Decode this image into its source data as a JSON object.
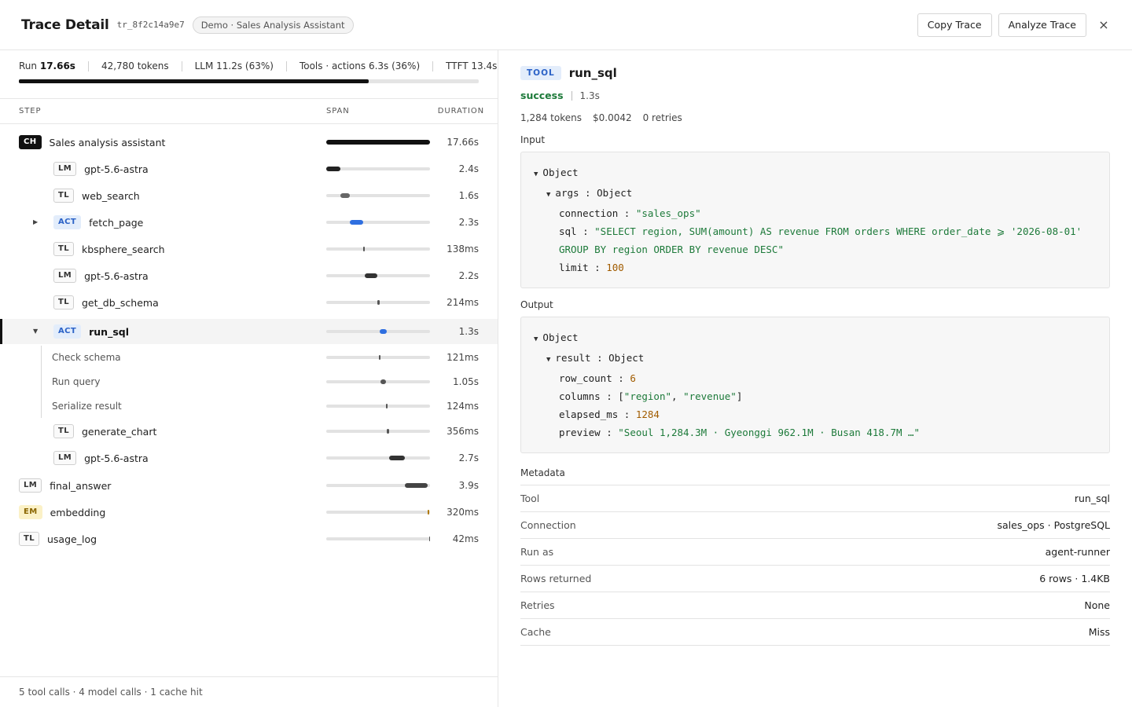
{
  "header": {
    "title": "Trace Detail",
    "trace_id": "tr_8f2c14a9e7",
    "demo_badge": "Demo · Sales Analysis Assistant",
    "copy_label": "Copy Trace",
    "analyze_label": "Analyze Trace",
    "close_icon": "×"
  },
  "summary": {
    "run_prefix": "Run",
    "run_value": "17.66s",
    "tokens": "42,780 tokens",
    "llm": "LLM 11.2s (63%)",
    "tools": "Tools · actions 6.3s (36%)",
    "ttft": "TTFT 13.4s",
    "progress_fraction": 0.76
  },
  "columns": {
    "step": "STEP",
    "span": "SPAN",
    "duration": "DURATION"
  },
  "rows": [
    {
      "tag": "CH",
      "name": "Sales analysis assistant",
      "duration": "17.66s"
    },
    {
      "tag": "LM",
      "name": "gpt-5.6-astra",
      "duration": "2.4s"
    },
    {
      "tag": "TL",
      "name": "web_search",
      "duration": "1.6s"
    },
    {
      "tag": "ACT",
      "name": "fetch_page",
      "duration": "2.3s"
    },
    {
      "tag": "TL",
      "name": "kbsphere_search",
      "duration": "138ms"
    },
    {
      "tag": "LM",
      "name": "gpt-5.6-astra",
      "duration": "2.2s"
    },
    {
      "tag": "TL",
      "name": "get_db_schema",
      "duration": "214ms"
    },
    {
      "tag": "ACT",
      "name": "run_sql",
      "duration": "1.3s"
    },
    {
      "name": "Check schema",
      "duration": "121ms"
    },
    {
      "name": "Run query",
      "duration": "1.05s"
    },
    {
      "name": "Serialize result",
      "duration": "124ms"
    },
    {
      "tag": "TL",
      "name": "generate_chart",
      "duration": "356ms"
    },
    {
      "tag": "LM",
      "name": "gpt-5.6-astra",
      "duration": "2.7s"
    },
    {
      "tag": "LM",
      "name": "final_answer",
      "duration": "3.9s"
    },
    {
      "tag": "EM",
      "name": "embedding",
      "duration": "320ms"
    },
    {
      "tag": "TL",
      "name": "usage_log",
      "duration": "42ms"
    }
  ],
  "footer": "5 tool calls · 4 model calls · 1 cache hit",
  "detail": {
    "badge": "TOOL",
    "title": "run_sql",
    "status": "success",
    "duration": "1.3s",
    "tokens": "1,284 tokens",
    "cost": "$0.0042",
    "retries": "0 retries",
    "input_label": "Input",
    "output_label": "Output",
    "obj": "Object",
    "args_key": "args",
    "connection_key": "connection",
    "connection_val": "\"sales_ops\"",
    "sql_key": "sql",
    "sql_val": "\"SELECT region, SUM(amount) AS revenue FROM orders WHERE order_date ⩾ '2026-08-01' GROUP BY region ORDER BY revenue DESC\"",
    "limit_key": "limit",
    "limit_val": "100",
    "result_key": "result",
    "row_count_key": "row_count",
    "row_count_val": "6",
    "columns_key": "columns",
    "col1": "\"region\"",
    "col2": "\"revenue\"",
    "elapsed_key": "elapsed_ms",
    "elapsed_val": "1284",
    "preview_key": "preview",
    "preview_val": "\"Seoul 1,284.3M · Gyeonggi 962.1M · Busan 418.7M …\"",
    "metadata_label": "Metadata",
    "meta": [
      {
        "label": "Tool",
        "value": "run_sql"
      },
      {
        "label": "Connection",
        "value": "sales_ops · PostgreSQL"
      },
      {
        "label": "Run as",
        "value": "agent-runner"
      },
      {
        "label": "Rows returned",
        "value": "6 rows · 1.4KB"
      },
      {
        "label": "Retries",
        "value": "None"
      },
      {
        "label": "Cache",
        "value": "Miss"
      }
    ]
  }
}
